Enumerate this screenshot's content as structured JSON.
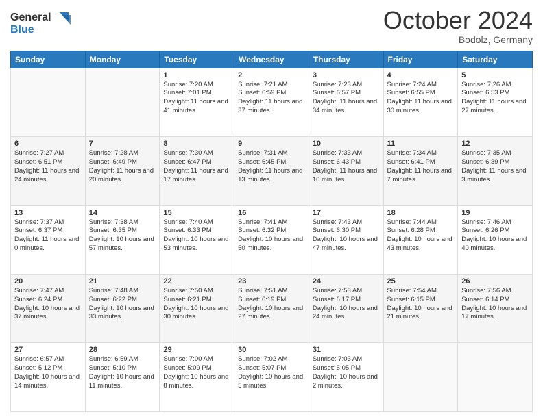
{
  "header": {
    "logo_general": "General",
    "logo_blue": "Blue",
    "month_title": "October 2024",
    "subtitle": "Bodolz, Germany"
  },
  "weekdays": [
    "Sunday",
    "Monday",
    "Tuesday",
    "Wednesday",
    "Thursday",
    "Friday",
    "Saturday"
  ],
  "weeks": [
    [
      {
        "day": "",
        "content": ""
      },
      {
        "day": "",
        "content": ""
      },
      {
        "day": "1",
        "content": "Sunrise: 7:20 AM\nSunset: 7:01 PM\nDaylight: 11 hours and 41 minutes."
      },
      {
        "day": "2",
        "content": "Sunrise: 7:21 AM\nSunset: 6:59 PM\nDaylight: 11 hours and 37 minutes."
      },
      {
        "day": "3",
        "content": "Sunrise: 7:23 AM\nSunset: 6:57 PM\nDaylight: 11 hours and 34 minutes."
      },
      {
        "day": "4",
        "content": "Sunrise: 7:24 AM\nSunset: 6:55 PM\nDaylight: 11 hours and 30 minutes."
      },
      {
        "day": "5",
        "content": "Sunrise: 7:26 AM\nSunset: 6:53 PM\nDaylight: 11 hours and 27 minutes."
      }
    ],
    [
      {
        "day": "6",
        "content": "Sunrise: 7:27 AM\nSunset: 6:51 PM\nDaylight: 11 hours and 24 minutes."
      },
      {
        "day": "7",
        "content": "Sunrise: 7:28 AM\nSunset: 6:49 PM\nDaylight: 11 hours and 20 minutes."
      },
      {
        "day": "8",
        "content": "Sunrise: 7:30 AM\nSunset: 6:47 PM\nDaylight: 11 hours and 17 minutes."
      },
      {
        "day": "9",
        "content": "Sunrise: 7:31 AM\nSunset: 6:45 PM\nDaylight: 11 hours and 13 minutes."
      },
      {
        "day": "10",
        "content": "Sunrise: 7:33 AM\nSunset: 6:43 PM\nDaylight: 11 hours and 10 minutes."
      },
      {
        "day": "11",
        "content": "Sunrise: 7:34 AM\nSunset: 6:41 PM\nDaylight: 11 hours and 7 minutes."
      },
      {
        "day": "12",
        "content": "Sunrise: 7:35 AM\nSunset: 6:39 PM\nDaylight: 11 hours and 3 minutes."
      }
    ],
    [
      {
        "day": "13",
        "content": "Sunrise: 7:37 AM\nSunset: 6:37 PM\nDaylight: 11 hours and 0 minutes."
      },
      {
        "day": "14",
        "content": "Sunrise: 7:38 AM\nSunset: 6:35 PM\nDaylight: 10 hours and 57 minutes."
      },
      {
        "day": "15",
        "content": "Sunrise: 7:40 AM\nSunset: 6:33 PM\nDaylight: 10 hours and 53 minutes."
      },
      {
        "day": "16",
        "content": "Sunrise: 7:41 AM\nSunset: 6:32 PM\nDaylight: 10 hours and 50 minutes."
      },
      {
        "day": "17",
        "content": "Sunrise: 7:43 AM\nSunset: 6:30 PM\nDaylight: 10 hours and 47 minutes."
      },
      {
        "day": "18",
        "content": "Sunrise: 7:44 AM\nSunset: 6:28 PM\nDaylight: 10 hours and 43 minutes."
      },
      {
        "day": "19",
        "content": "Sunrise: 7:46 AM\nSunset: 6:26 PM\nDaylight: 10 hours and 40 minutes."
      }
    ],
    [
      {
        "day": "20",
        "content": "Sunrise: 7:47 AM\nSunset: 6:24 PM\nDaylight: 10 hours and 37 minutes."
      },
      {
        "day": "21",
        "content": "Sunrise: 7:48 AM\nSunset: 6:22 PM\nDaylight: 10 hours and 33 minutes."
      },
      {
        "day": "22",
        "content": "Sunrise: 7:50 AM\nSunset: 6:21 PM\nDaylight: 10 hours and 30 minutes."
      },
      {
        "day": "23",
        "content": "Sunrise: 7:51 AM\nSunset: 6:19 PM\nDaylight: 10 hours and 27 minutes."
      },
      {
        "day": "24",
        "content": "Sunrise: 7:53 AM\nSunset: 6:17 PM\nDaylight: 10 hours and 24 minutes."
      },
      {
        "day": "25",
        "content": "Sunrise: 7:54 AM\nSunset: 6:15 PM\nDaylight: 10 hours and 21 minutes."
      },
      {
        "day": "26",
        "content": "Sunrise: 7:56 AM\nSunset: 6:14 PM\nDaylight: 10 hours and 17 minutes."
      }
    ],
    [
      {
        "day": "27",
        "content": "Sunrise: 6:57 AM\nSunset: 5:12 PM\nDaylight: 10 hours and 14 minutes."
      },
      {
        "day": "28",
        "content": "Sunrise: 6:59 AM\nSunset: 5:10 PM\nDaylight: 10 hours and 11 minutes."
      },
      {
        "day": "29",
        "content": "Sunrise: 7:00 AM\nSunset: 5:09 PM\nDaylight: 10 hours and 8 minutes."
      },
      {
        "day": "30",
        "content": "Sunrise: 7:02 AM\nSunset: 5:07 PM\nDaylight: 10 hours and 5 minutes."
      },
      {
        "day": "31",
        "content": "Sunrise: 7:03 AM\nSunset: 5:05 PM\nDaylight: 10 hours and 2 minutes."
      },
      {
        "day": "",
        "content": ""
      },
      {
        "day": "",
        "content": ""
      }
    ]
  ]
}
